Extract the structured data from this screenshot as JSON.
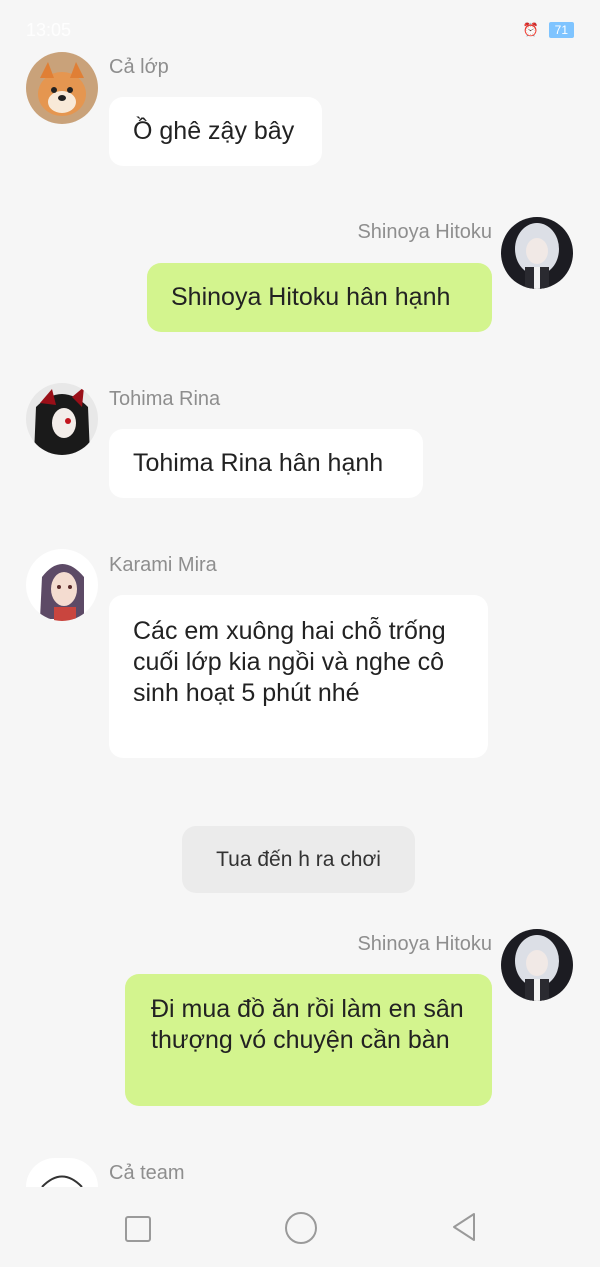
{
  "status_bar": {
    "time": "13:05",
    "battery": "71"
  },
  "messages": [
    {
      "sender": "Cả lớp",
      "text": "Ồ ghê zậy bây",
      "outgoing": false
    },
    {
      "sender": "Shinoya Hitoku",
      "text": "Shinoya Hitoku hân hạnh",
      "outgoing": true
    },
    {
      "sender": "Tohima Rina",
      "text": "Tohima Rina hân hạnh",
      "outgoing": false
    },
    {
      "sender": "Karami Mira",
      "text": "Các em xuông hai chỗ trống cuối lớp kia ngồi và nghe cô sinh hoạt 5 phút nhé",
      "outgoing": false
    },
    {
      "sender": "Shinoya Hitoku",
      "text": "Đi mua đồ ăn rồi làm en sân thượng vó chuyện cần bàn",
      "outgoing": true
    },
    {
      "sender": "Cả team",
      "text": "",
      "outgoing": false
    }
  ],
  "system_message": "Tua đến h ra chơi",
  "nav": {
    "recent_icon": "square-icon",
    "home_icon": "circle-icon",
    "back_icon": "triangle-back-icon"
  },
  "colors": {
    "background": "#f6f6f6",
    "incoming_bubble": "#ffffff",
    "outgoing_bubble": "#d3f48e",
    "name_text": "#8e8e8e"
  }
}
